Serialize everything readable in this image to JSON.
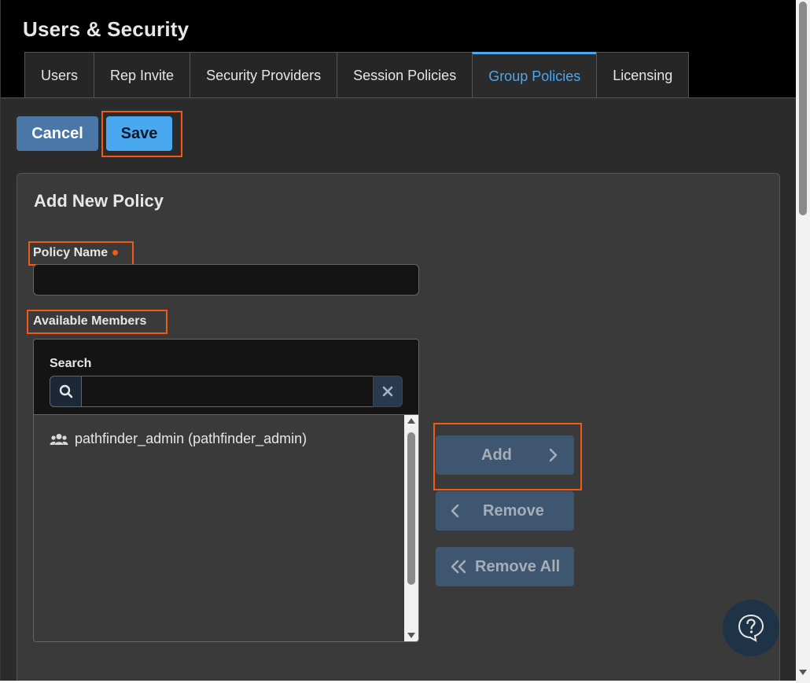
{
  "app": {
    "title": "Users & Security"
  },
  "tabs": [
    {
      "label": "Users"
    },
    {
      "label": "Rep Invite"
    },
    {
      "label": "Security Providers"
    },
    {
      "label": "Session Policies"
    },
    {
      "label": "Group Policies",
      "active": true
    },
    {
      "label": "Licensing"
    }
  ],
  "toolbar": {
    "cancel_label": "Cancel",
    "save_label": "Save"
  },
  "form": {
    "title": "Add New Policy",
    "policy_name_label": "Policy Name",
    "policy_name_value": "",
    "available_members_label": "Available Members",
    "search_label": "Search",
    "search_value": "",
    "members": [
      {
        "label": "pathfinder_admin (pathfinder_admin)",
        "icon": "users-group-icon"
      }
    ]
  },
  "actions": {
    "add_label": "Add",
    "remove_label": "Remove",
    "remove_all_label": "Remove All"
  },
  "colors": {
    "accent": "#4aa8f0",
    "highlight": "#f05a14",
    "background": "#2b2b2b",
    "header": "#000000"
  }
}
